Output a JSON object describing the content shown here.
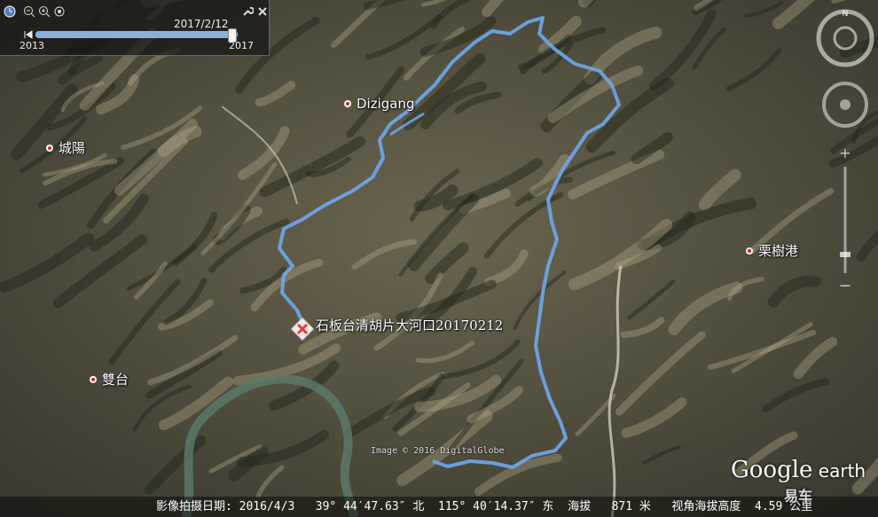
{
  "timebar": {
    "current_date": "2017/2/12",
    "start_year": "2013",
    "end_year": "2017",
    "slider_position": 0.97,
    "icons": [
      "clock-icon",
      "zoom-out-icon",
      "zoom-in-icon",
      "settings-icon",
      "close-icon",
      "wrench-icon",
      "play-back-icon"
    ]
  },
  "places": {
    "dizigang": "Dizigang",
    "chengyang": "城陽",
    "lishugang": "栗樹港",
    "shuangtai": "雙台"
  },
  "waypoint": {
    "label": "石板台清胡片大河口20170212",
    "icon": "x-marker-icon"
  },
  "route": {
    "color": "#6ea3e6"
  },
  "copyright": "Image © 2016 DigitalGlobe",
  "logo": {
    "google": "Google",
    "earth": "earth"
  },
  "status": {
    "imagery_date_label": "影像拍摄日期:",
    "imagery_date": "2016/4/3",
    "lat": "39° 44′47.63″ 北",
    "lon": "115° 40′14.37″ 东",
    "elev_label": "海拔",
    "elev": "871 米",
    "eye_label": "视角海拔高度",
    "eye": "4.59 公里"
  },
  "watermark": "易车"
}
